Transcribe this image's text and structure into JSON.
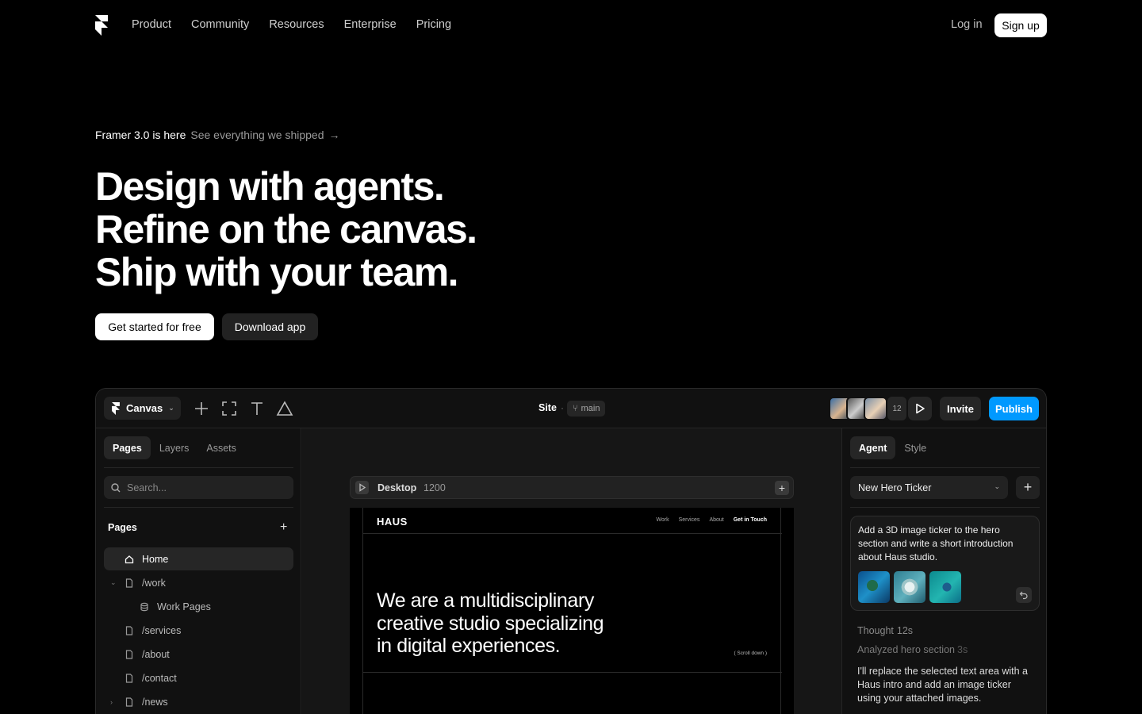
{
  "nav": {
    "links": [
      "Product",
      "Community",
      "Resources",
      "Enterprise",
      "Pricing"
    ],
    "login": "Log in",
    "signup": "Sign up"
  },
  "hero": {
    "announce_title": "Framer 3.0 is here",
    "announce_link": "See everything we shipped",
    "headline": [
      "Design with agents.",
      "Refine on the canvas.",
      "Ship with your team."
    ],
    "cta_primary": "Get started for free",
    "cta_secondary": "Download app"
  },
  "app": {
    "toolbar": {
      "canvas_label": "Canvas",
      "site_label": "Site",
      "separator": "·",
      "branch": "main",
      "collaborator_count": "12",
      "invite": "Invite",
      "publish": "Publish"
    },
    "left": {
      "tabs": [
        "Pages",
        "Layers",
        "Assets"
      ],
      "search_placeholder": "Search...",
      "pages_heading": "Pages",
      "pages": [
        {
          "label": "Home",
          "icon": "home-icon"
        },
        {
          "label": "/work",
          "icon": "page-icon",
          "expanded": true
        },
        {
          "label": "Work Pages",
          "icon": "database-icon"
        },
        {
          "label": "/services",
          "icon": "page-icon"
        },
        {
          "label": "/about",
          "icon": "page-icon"
        },
        {
          "label": "/contact",
          "icon": "page-icon"
        },
        {
          "label": "/news",
          "icon": "page-icon",
          "collapsed": true
        }
      ]
    },
    "canvas": {
      "breakpoint": "Desktop",
      "width": "1200",
      "site": {
        "logo": "HAUS",
        "nav": [
          "Work",
          "Services",
          "About",
          "Get in Touch"
        ],
        "hero_lines": [
          "We are a multidisciplinary",
          "creative studio specializing",
          "in digital experiences."
        ],
        "scroll_hint": "( Scroll down )"
      }
    },
    "right": {
      "tabs": [
        "Agent",
        "Style"
      ],
      "select_value": "New Hero Ticker",
      "prompt": "Add a 3D image ticker to the hero section and write a short introduction about Haus studio.",
      "thought_label": "Thought",
      "thought_time": "12s",
      "analyzed_label": "Analyzed hero section",
      "analyzed_time": "3s",
      "reply": "I'll replace the selected text area with a Haus intro and add an image ticker using your attached images."
    }
  },
  "colors": {
    "background": "#000000",
    "accent": "#0099ff",
    "panel": "#111111"
  }
}
